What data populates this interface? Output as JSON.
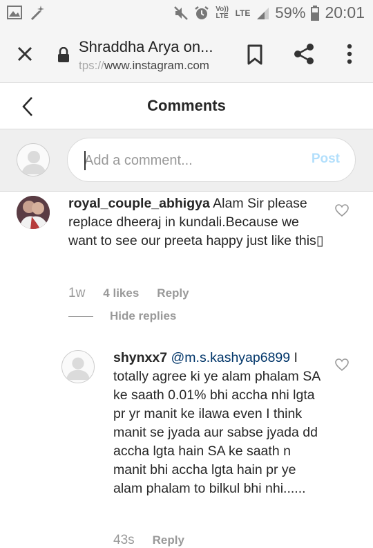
{
  "status_bar": {
    "volte": "Vo)) LTE",
    "lte": "LTE",
    "battery": "59%",
    "time": "20:01",
    "icons": [
      "image-icon",
      "magic-wand-icon",
      "mute-icon",
      "alarm-icon",
      "signal-icon",
      "battery-icon"
    ]
  },
  "browser": {
    "title": "Shraddha Arya on...",
    "url_fade": "tps://",
    "url": "www.instagram.com",
    "icons": [
      "close-icon",
      "lock-icon",
      "bookmark-icon",
      "share-icon",
      "more-vert-icon"
    ]
  },
  "header": {
    "title": "Comments",
    "back_icon": "chevron-left-icon"
  },
  "composer": {
    "placeholder": "Add a comment...",
    "post_label": "Post"
  },
  "comments": [
    {
      "username": "royal_couple_abhigya",
      "text": "Alam Sir please replace dheeraj in kundali.Because we want to see our preeta happy just like this▯",
      "time": "1w",
      "likes": "4 likes",
      "reply_label": "Reply",
      "hide_replies_label": "Hide replies"
    },
    {
      "username": "shynxx7",
      "mention": "@m.s.kashyap6899",
      "text": "I totally agree ki ye alam phalam SA ke saath 0.01% bhi accha nhi lgta pr yr manit ke ilawa even I think manit se jyada aur sabse jyada dd accha lgta hain SA ke saath n manit bhi accha lgta hain pr ye alam phalam to bilkul bhi nhi......",
      "time": "43s",
      "reply_label": "Reply"
    }
  ],
  "colors": {
    "post_disabled": "#b2dffc",
    "mention": "#003569",
    "meta": "#999999"
  }
}
